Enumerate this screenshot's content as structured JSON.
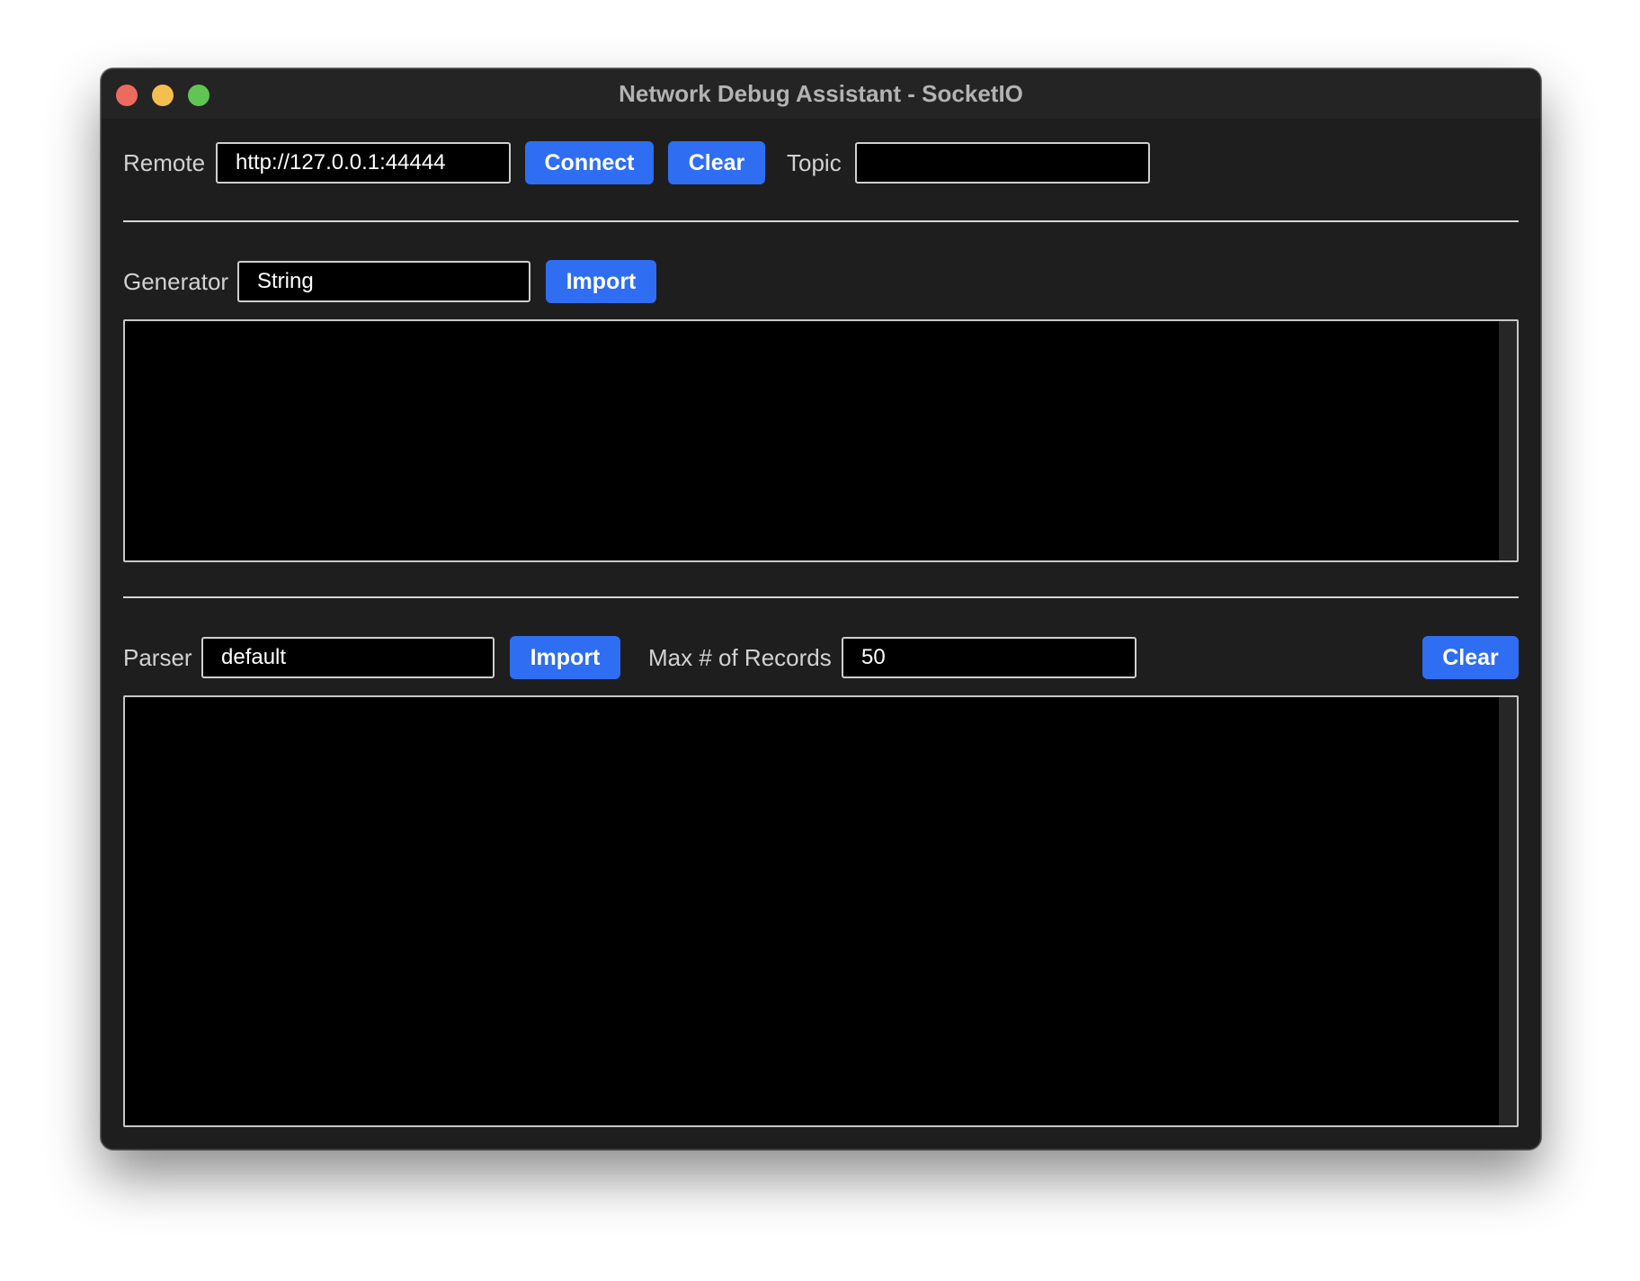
{
  "window": {
    "title": "Network Debug Assistant - SocketIO"
  },
  "connection": {
    "remote_label": "Remote",
    "remote_value": "http://127.0.0.1:44444",
    "connect_button": "Connect",
    "clear_button": "Clear",
    "topic_label": "Topic",
    "topic_value": ""
  },
  "generator": {
    "label": "Generator",
    "value": "String",
    "import_button": "Import",
    "content": ""
  },
  "parser": {
    "label": "Parser",
    "value": "default",
    "import_button": "Import",
    "max_records_label": "Max # of Records",
    "max_records_value": "50",
    "clear_button": "Clear",
    "content": ""
  },
  "colors": {
    "accent": "#2f6ef2",
    "window_bg": "#1e1e1e",
    "field_bg": "#000000",
    "traffic_close": "#ed6a5e",
    "traffic_minimize": "#f5bf4f",
    "traffic_maximize": "#61c554"
  }
}
